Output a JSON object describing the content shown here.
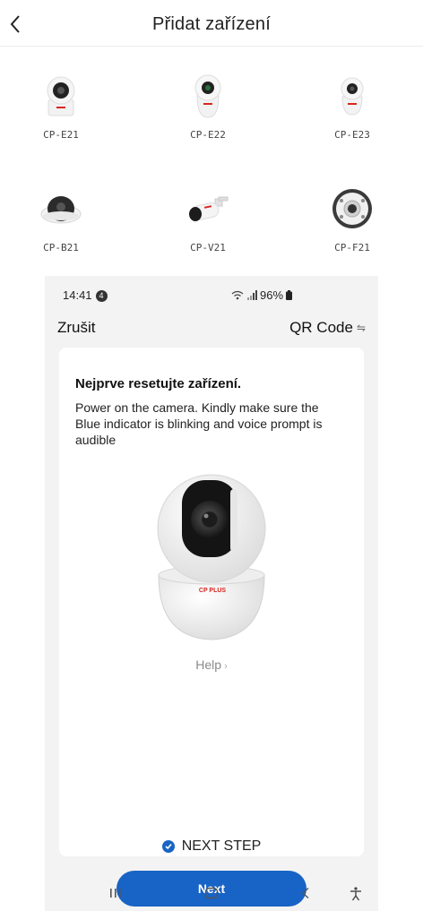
{
  "header": {
    "title": "Přidat zařízení"
  },
  "devices": [
    {
      "label": "CP-E21",
      "icon": "dome-camera-icon"
    },
    {
      "label": "CP-E22",
      "icon": "pan-tilt-camera-icon"
    },
    {
      "label": "CP-E23",
      "icon": "mini-camera-icon"
    },
    {
      "label": "CP-B21",
      "icon": "ceiling-dome-camera-icon"
    },
    {
      "label": "CP-V21",
      "icon": "bullet-camera-icon"
    },
    {
      "label": "CP-F21",
      "icon": "fisheye-camera-icon"
    }
  ],
  "phone": {
    "status": {
      "time": "14:41",
      "notification_count": "4",
      "battery": "96%"
    },
    "topbar": {
      "cancel": "Zrušit",
      "qr": "QR Code"
    },
    "card": {
      "title": "Nejprve resetujte zařízení.",
      "description": "Power on the camera. Kindly make sure the Blue indicator is blinking and voice prompt is audible",
      "brand": "CP PLUS",
      "help": "Help",
      "next_step": "NEXT STEP",
      "next_button": "Next"
    }
  },
  "colors": {
    "accent": "#1863c6",
    "brand_red": "#d8261f"
  }
}
